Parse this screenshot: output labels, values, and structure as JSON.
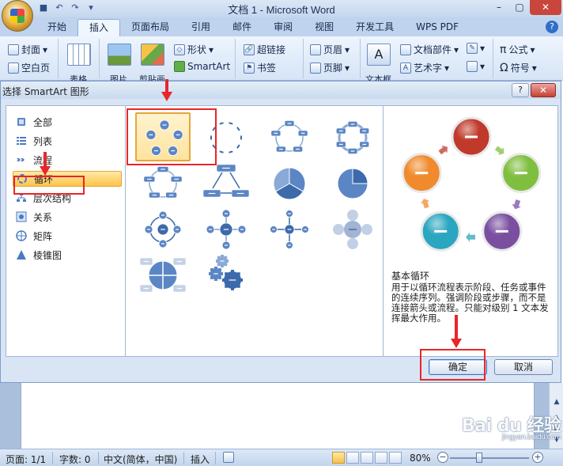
{
  "window": {
    "title": "文档 1 - Microsoft Word",
    "controls": {
      "minimize": "–",
      "maximize": "▢",
      "close": "✕"
    }
  },
  "quick_access": [
    "save-icon",
    "undo-icon",
    "redo-icon",
    "customize-icon"
  ],
  "ribbon": {
    "tabs": [
      "开始",
      "插入",
      "页面布局",
      "引用",
      "邮件",
      "审阅",
      "视图",
      "开发工具",
      "WPS PDF"
    ],
    "active_tab": "插入",
    "pages": {
      "cover": "封面",
      "blank": "空白页"
    },
    "table_label": "表格",
    "picture_label": "图片",
    "clipart_label": "剪贴画",
    "shapes_label": "形状",
    "smartart_label": "SmartArt",
    "hyperlink_label": "超链接",
    "bookmark_label": "书签",
    "header_label": "页眉",
    "footer_label": "页脚",
    "textbox_label": "文本框",
    "quickparts_label": "文档部件",
    "wordart_label": "艺术字",
    "formula_label": "公式",
    "symbol_label": "符号"
  },
  "dialog": {
    "title": "选择 SmartArt 图形",
    "help": "?",
    "close": "✕",
    "categories": [
      {
        "label": "全部",
        "icon": "all-icon"
      },
      {
        "label": "列表",
        "icon": "list-icon"
      },
      {
        "label": "流程",
        "icon": "process-icon"
      },
      {
        "label": "循环",
        "icon": "cycle-icon"
      },
      {
        "label": "层次结构",
        "icon": "hierarchy-icon"
      },
      {
        "label": "关系",
        "icon": "relationship-icon"
      },
      {
        "label": "矩阵",
        "icon": "matrix-icon"
      },
      {
        "label": "棱锥图",
        "icon": "pyramid-icon"
      }
    ],
    "selected_category": "循环",
    "layouts": [
      "basic-cycle",
      "text-cycle",
      "block-cycle",
      "continuous-cycle",
      "nondirectional-cycle",
      "multidirectional-cycle",
      "segmented-cycle",
      "basic-pie",
      "radial-cycle",
      "basic-radial",
      "diverging-radial",
      "radial-venn",
      "cycle-matrix",
      "gear"
    ],
    "selected_layout": "basic-cycle",
    "preview": {
      "name": "基本循环",
      "description": "用于以循环流程表示阶段、任务或事件的连续序列。强调阶段或步骤，而不是连接箭头或流程。只能对级别 1 文本发挥最大作用。",
      "colors": [
        "#c0392b",
        "#7fbf3f",
        "#7a4fa0",
        "#2aa6c0",
        "#f08a2c"
      ]
    },
    "ok_label": "确定",
    "cancel_label": "取消"
  },
  "statusbar": {
    "page": "页面: 1/1",
    "words": "字数: 0",
    "language": "中文(简体，中国)",
    "mode": "插入",
    "zoom": "80%",
    "zoom_minus": "−",
    "zoom_plus": "+"
  },
  "watermark": {
    "text": "Bai du 经验",
    "sub": "jingyan.baidu.com"
  }
}
